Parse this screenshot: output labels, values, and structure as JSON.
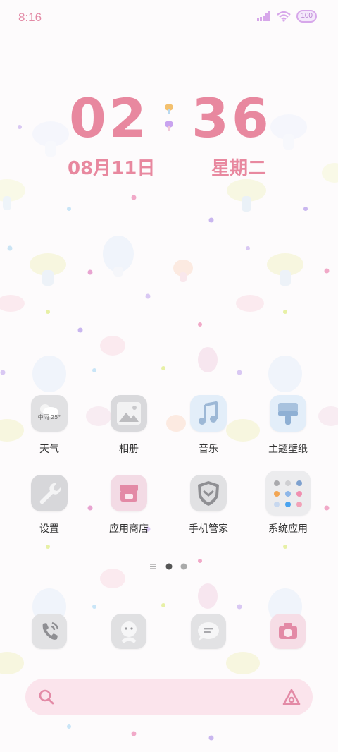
{
  "status_bar": {
    "time": "8:16",
    "battery": "100"
  },
  "clock": {
    "hours": "02",
    "minutes": "36",
    "date": "08月11日",
    "weekday": "星期二"
  },
  "apps": [
    {
      "label": "天气",
      "icon": "weather-icon",
      "widget_text": "中雨 25°"
    },
    {
      "label": "相册",
      "icon": "gallery-icon"
    },
    {
      "label": "音乐",
      "icon": "music-icon"
    },
    {
      "label": "主题壁纸",
      "icon": "theme-brush-icon"
    },
    {
      "label": "设置",
      "icon": "settings-wrench-icon"
    },
    {
      "label": "应用商店",
      "icon": "app-store-icon"
    },
    {
      "label": "手机管家",
      "icon": "phone-manager-shield-icon"
    },
    {
      "label": "系统应用",
      "icon": "system-apps-folder-icon"
    }
  ],
  "page_indicator": {
    "pages": 2,
    "current": 1
  },
  "dock": [
    {
      "icon": "phone-icon"
    },
    {
      "icon": "contacts-icon"
    },
    {
      "icon": "messages-icon"
    },
    {
      "icon": "camera-icon"
    }
  ],
  "colors": {
    "accent_pink": "#e8889f",
    "search_bg": "#fbe4ec",
    "status_purple": "#d7a7ea"
  }
}
